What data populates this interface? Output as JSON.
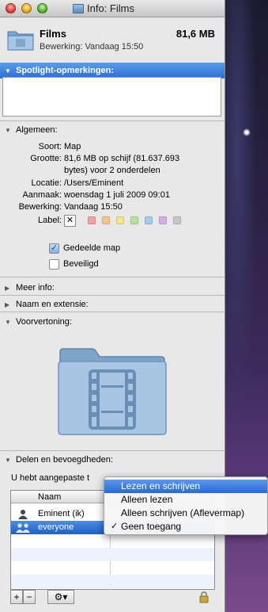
{
  "window": {
    "title": "Info: Films"
  },
  "header": {
    "name": "Films",
    "size": "81,6 MB",
    "modified_label": "Bewerking:",
    "modified_value": "Vandaag 15:50"
  },
  "sections": {
    "spotlight": "Spotlight-opmerkingen:",
    "general": "Algemeen:",
    "more_info": "Meer info:",
    "name_ext": "Naam en extensie:",
    "preview": "Voorvertoning:",
    "sharing": "Delen en bevoegdheden:"
  },
  "general": {
    "kind_label": "Soort:",
    "kind_value": "Map",
    "size_label": "Grootte:",
    "size_value_1": "81,6 MB op schijf (81.637.693",
    "size_value_2": "bytes) voor 2 onderdelen",
    "location_label": "Locatie:",
    "location_value": "/Users/Eminent",
    "created_label": "Aanmaak:",
    "created_value": "woensdag 1 juli 2009 09:01",
    "modified_label": "Bewerking:",
    "modified_value": "Vandaag 15:50",
    "label_label": "Label:",
    "label_x": "✕",
    "swatch_colors": [
      "#f2a0a0",
      "#f5c48a",
      "#f2e58c",
      "#b8e0a0",
      "#a8c8f0",
      "#d2b0e6",
      "#c8c8c8"
    ],
    "shared_folder": "Gedeelde map",
    "locked": "Beveiligd"
  },
  "sharing": {
    "notice": "U hebt aangepaste t",
    "col_name": "Naam",
    "col_priv": "",
    "rows": [
      {
        "name": "Eminent (ik)"
      },
      {
        "name": "everyone"
      }
    ],
    "add_btn": "+",
    "remove_btn": "−",
    "action_btn": "⚙▾"
  },
  "menu": {
    "items": [
      {
        "label": "Lezen en schrijven",
        "checked": ""
      },
      {
        "label": "Alleen lezen",
        "checked": ""
      },
      {
        "label": "Alleen schrijven (Aflevermap)",
        "checked": ""
      },
      {
        "label": "Geen toegang",
        "checked": "✓"
      }
    ]
  }
}
